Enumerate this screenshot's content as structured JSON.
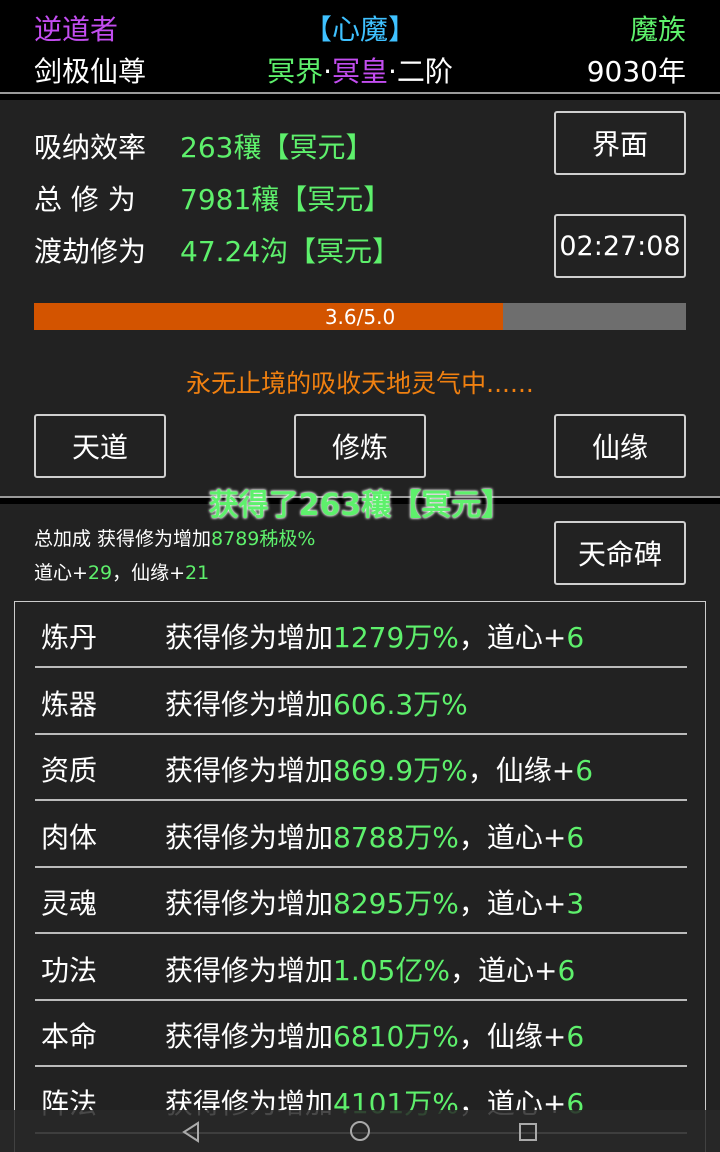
{
  "header": {
    "name": "逆道者",
    "heart_demon": "【心魔】",
    "race": "魔族",
    "title": "剑极仙尊",
    "realm_a": "冥界",
    "dot1": "·",
    "realm_b": "冥皇",
    "dot2": "·",
    "stage": "二阶",
    "age": "9030年"
  },
  "stats": {
    "absorb_label": "吸纳效率",
    "absorb_value": "263穰【冥元】",
    "total_label": "总 修 为",
    "total_value": "7981穰【冥元】",
    "tribulation_label": "渡劫修为",
    "tribulation_value": "47.24沟【冥元】"
  },
  "buttons": {
    "interface": "界面",
    "timer": "02:27:08",
    "tiandao": "天道",
    "cultivate": "修炼",
    "xianyuan": "仙缘",
    "tianming": "天命碑"
  },
  "progress": {
    "text": "3.6/5.0",
    "value": 3.6,
    "max": 5.0
  },
  "status_message": "永无止境的吸收天地灵气中......",
  "gain_popup": "获得了263穰【冥元】",
  "bonus": {
    "prefix": "总加成 获得修为增加",
    "value": "8789秭极%",
    "dao_label": "道心+",
    "dao_value": "29",
    "sep": "，",
    "xian_label": "仙缘+",
    "xian_value": "21"
  },
  "rows": [
    {
      "name": "炼丹",
      "prefix": "获得修为增加",
      "value": "1279万%",
      "suffix_label": "，道心+",
      "suffix_value": "6"
    },
    {
      "name": "炼器",
      "prefix": "获得修为增加",
      "value": "606.3万%",
      "suffix_label": "",
      "suffix_value": ""
    },
    {
      "name": "资质",
      "prefix": "获得修为增加",
      "value": "869.9万%",
      "suffix_label": "，仙缘+",
      "suffix_value": "6"
    },
    {
      "name": "肉体",
      "prefix": "获得修为增加",
      "value": "8788万%",
      "suffix_label": "，道心+",
      "suffix_value": "6"
    },
    {
      "name": "灵魂",
      "prefix": "获得修为增加",
      "value": "8295万%",
      "suffix_label": "，道心+",
      "suffix_value": "3"
    },
    {
      "name": "功法",
      "prefix": "获得修为增加",
      "value": "1.05亿%",
      "suffix_label": "，道心+",
      "suffix_value": "6"
    },
    {
      "name": "本命",
      "prefix": "获得修为增加",
      "value": "6810万%",
      "suffix_label": "，仙缘+",
      "suffix_value": "6"
    },
    {
      "name": "阵法",
      "prefix": "获得修为增加",
      "value": "4101万%",
      "suffix_label": "，道心+",
      "suffix_value": "6"
    }
  ],
  "colors": {
    "accent_green": "#5ef06c",
    "accent_purple": "#c34df0",
    "accent_cyan": "#3fc1ff",
    "orange": "#f08010",
    "progress_fill": "#d35400"
  },
  "navbar": {
    "back": "back-icon",
    "home": "home-icon",
    "recents": "recents-icon"
  }
}
